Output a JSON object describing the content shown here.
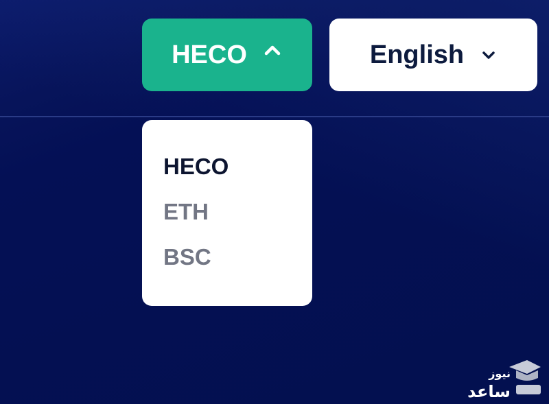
{
  "header": {
    "network_selector": {
      "label": "HECO",
      "icon": "chevron-up-icon",
      "color": "#1ab38d"
    },
    "language_selector": {
      "label": "English",
      "icon": "chevron-down-icon"
    }
  },
  "network_dropdown": {
    "items": [
      {
        "label": "HECO",
        "selected": true
      },
      {
        "label": "ETH",
        "selected": false
      },
      {
        "label": "BSC",
        "selected": false
      }
    ]
  },
  "watermark": {
    "line1": "نیوز",
    "line2": "ساعد",
    "icon": "graduation-cap-icon"
  }
}
